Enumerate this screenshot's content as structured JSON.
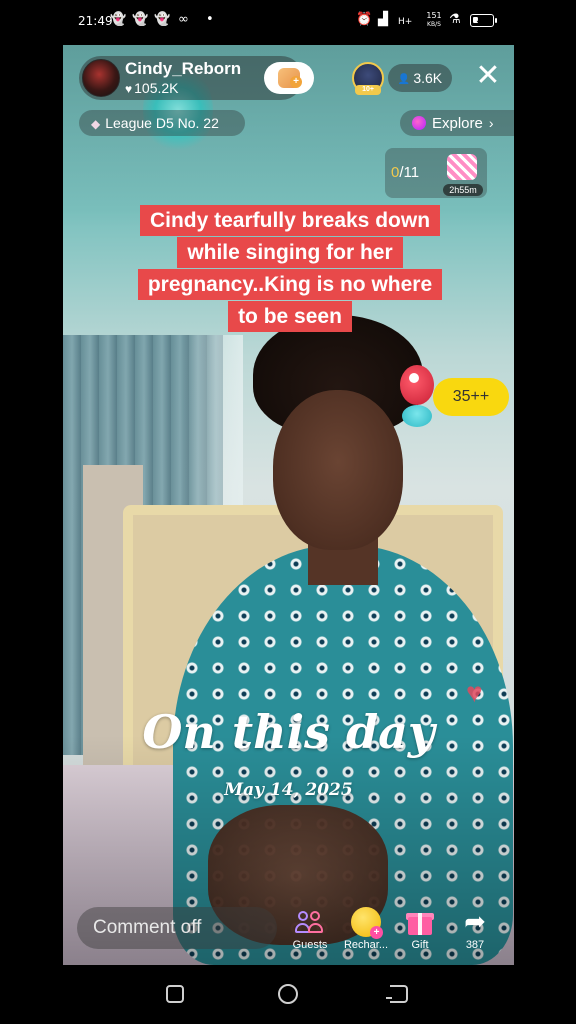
{
  "status_bar": {
    "time": "21:49",
    "notification_icons": [
      "snapchat-icon",
      "snapchat-icon",
      "snapchat-icon",
      "infinity-icon",
      "dot-icon"
    ],
    "network_speed_value": "151",
    "network_speed_unit": "KB/S",
    "network_type": "H+",
    "battery_level": "31"
  },
  "live": {
    "host": {
      "name": "Cindy_Reborn",
      "likes": "105.2K"
    },
    "top_gifter_badge": "10+",
    "viewer_count": "3.6K",
    "league": "League D5 No. 22",
    "explore_label": "Explore",
    "goal": {
      "current": "0",
      "total": "/11",
      "timer": "2h55m"
    },
    "caption_lines": [
      "Cindy tearfully breaks down",
      "while singing for her",
      "pregnancy..King is no where",
      "to be seen"
    ],
    "sticker_count": "35++"
  },
  "memory": {
    "title": "On this day",
    "date": "May 14, 2025"
  },
  "bottom_bar": {
    "comment_placeholder": "Comment off",
    "actions": [
      {
        "label": "Guests",
        "icon": "guests-icon"
      },
      {
        "label": "Rechar...",
        "icon": "coin-icon"
      },
      {
        "label": "Gift",
        "icon": "gift-icon"
      },
      {
        "label": "387",
        "icon": "share-icon"
      }
    ]
  },
  "colors": {
    "caption_bg": "#e8494a",
    "badge_yellow": "#f9d80f",
    "accent_gold": "#f2c94c"
  }
}
